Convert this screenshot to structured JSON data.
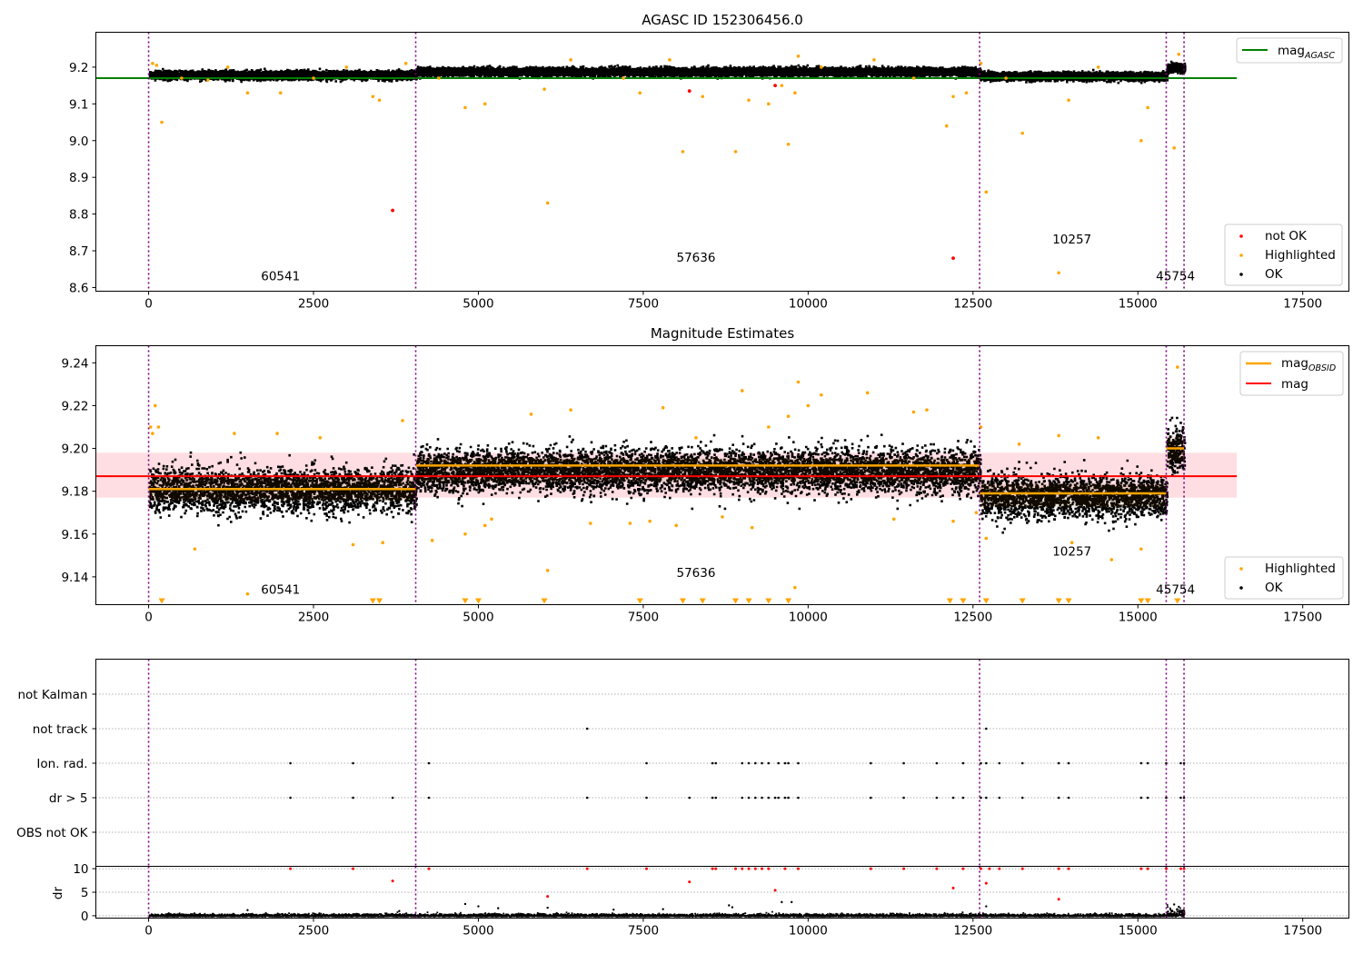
{
  "chart_data": [
    {
      "type": "scatter",
      "title": "AGASC ID 152306456.0",
      "xlabel": "",
      "ylabel": "",
      "xlim": [
        -800,
        18200
      ],
      "ylim": [
        8.59,
        9.295
      ],
      "xticks": [
        0,
        2500,
        5000,
        7500,
        10000,
        12500,
        15000,
        17500
      ],
      "xtick_labels": [
        "0",
        "2500",
        "5000",
        "7500",
        "10000",
        "12500",
        "15000",
        "17500"
      ],
      "yticks": [
        8.6,
        8.7,
        8.8,
        8.9,
        9.0,
        9.1,
        9.2
      ],
      "ytick_labels": [
        "8.6",
        "8.7",
        "8.8",
        "8.9",
        "9.0",
        "9.1",
        "9.2"
      ],
      "obsid_boundaries": [
        0,
        4050,
        12600,
        15430,
        15700
      ],
      "obsid_labels": [
        {
          "text": "60541",
          "x": 2000,
          "y": 8.62
        },
        {
          "text": "57636",
          "x": 8300,
          "y": 8.67
        },
        {
          "text": "10257",
          "x": 14000,
          "y": 8.72
        },
        {
          "text": "45754",
          "x": 15570,
          "y": 8.62
        }
      ],
      "lines": [
        {
          "name": "mag_AGASC",
          "y": 9.17,
          "x_range": [
            -800,
            16500
          ],
          "color": "#008000"
        }
      ],
      "ok_bands": [
        {
          "x_range": [
            0,
            4050
          ],
          "center": 9.181,
          "spread": 0.011
        },
        {
          "x_range": [
            4050,
            12600
          ],
          "center": 9.19,
          "spread": 0.011
        },
        {
          "x_range": [
            12600,
            15430
          ],
          "center": 9.178,
          "spread": 0.011
        },
        {
          "x_range": [
            15430,
            15700
          ],
          "center": 9.2,
          "spread": 0.012
        }
      ],
      "highlighted_points": [
        [
          60,
          9.21
        ],
        [
          120,
          9.205
        ],
        [
          200,
          9.05
        ],
        [
          500,
          9.17
        ],
        [
          900,
          9.165
        ],
        [
          1200,
          9.2
        ],
        [
          1500,
          9.13
        ],
        [
          2000,
          9.13
        ],
        [
          2500,
          9.17
        ],
        [
          3000,
          9.2
        ],
        [
          3400,
          9.12
        ],
        [
          3500,
          9.11
        ],
        [
          3900,
          9.21
        ],
        [
          4400,
          9.17
        ],
        [
          4800,
          9.09
        ],
        [
          5100,
          9.1
        ],
        [
          6000,
          9.14
        ],
        [
          6050,
          8.83
        ],
        [
          6400,
          9.22
        ],
        [
          7200,
          9.17
        ],
        [
          7450,
          9.13
        ],
        [
          7900,
          9.22
        ],
        [
          8100,
          8.97
        ],
        [
          8400,
          9.12
        ],
        [
          8900,
          8.97
        ],
        [
          9100,
          9.11
        ],
        [
          9400,
          9.1
        ],
        [
          9600,
          9.15
        ],
        [
          9700,
          8.99
        ],
        [
          9800,
          9.13
        ],
        [
          9850,
          9.23
        ],
        [
          10200,
          9.2
        ],
        [
          11000,
          9.22
        ],
        [
          11600,
          9.17
        ],
        [
          12100,
          9.04
        ],
        [
          12200,
          9.12
        ],
        [
          12400,
          9.13
        ],
        [
          12620,
          9.21
        ],
        [
          12700,
          8.86
        ],
        [
          13000,
          9.17
        ],
        [
          13250,
          9.02
        ],
        [
          13800,
          8.64
        ],
        [
          13950,
          9.11
        ],
        [
          14400,
          9.2
        ],
        [
          15050,
          9.0
        ],
        [
          15150,
          9.09
        ],
        [
          15550,
          8.98
        ],
        [
          15620,
          9.235
        ]
      ],
      "not_ok_points": [
        [
          3700,
          8.81
        ],
        [
          8200,
          9.135
        ],
        [
          9500,
          9.15
        ],
        [
          12200,
          8.68
        ]
      ],
      "legend": [
        {
          "name": "mag_AGASC",
          "position": "top-right"
        },
        {
          "name": "not OK",
          "position": "bottom-right"
        },
        {
          "name": "Highlighted",
          "position": "bottom-right"
        },
        {
          "name": "OK",
          "position": "bottom-right"
        }
      ],
      "grid": false
    },
    {
      "type": "scatter",
      "title": "Magnitude Estimates",
      "xlabel": "",
      "ylabel": "",
      "xlim": [
        -800,
        18200
      ],
      "ylim": [
        9.127,
        9.248
      ],
      "xticks": [
        0,
        2500,
        5000,
        7500,
        10000,
        12500,
        15000,
        17500
      ],
      "xtick_labels": [
        "0",
        "2500",
        "5000",
        "7500",
        "10000",
        "12500",
        "15000",
        "17500"
      ],
      "yticks": [
        9.14,
        9.16,
        9.18,
        9.2,
        9.22,
        9.24
      ],
      "ytick_labels": [
        "9.14",
        "9.16",
        "9.18",
        "9.20",
        "9.22",
        "9.24"
      ],
      "obsid_boundaries": [
        0,
        4050,
        12600,
        15430,
        15700
      ],
      "obsid_labels": [
        {
          "text": "60541",
          "x": 2000,
          "y": 9.132
        },
        {
          "text": "57636",
          "x": 8300,
          "y": 9.14
        },
        {
          "text": "10257",
          "x": 14000,
          "y": 9.15
        },
        {
          "text": "45754",
          "x": 15570,
          "y": 9.132
        }
      ],
      "mag": {
        "value": 9.187,
        "band": [
          9.177,
          9.198
        ],
        "x_range": [
          -800,
          16500
        ],
        "color": "#ff0000"
      },
      "mag_obsid": [
        {
          "x_range": [
            0,
            4050
          ],
          "value": 9.181
        },
        {
          "x_range": [
            4050,
            12600
          ],
          "value": 9.192
        },
        {
          "x_range": [
            12600,
            15430
          ],
          "value": 9.179
        },
        {
          "x_range": [
            15430,
            15700
          ],
          "value": 9.2
        }
      ],
      "ok_bands": [
        {
          "x_range": [
            0,
            4050
          ],
          "center": 9.181,
          "spread": 0.011
        },
        {
          "x_range": [
            4050,
            12600
          ],
          "center": 9.19,
          "spread": 0.011
        },
        {
          "x_range": [
            12600,
            15430
          ],
          "center": 9.178,
          "spread": 0.011
        },
        {
          "x_range": [
            15430,
            15700
          ],
          "center": 9.2,
          "spread": 0.012
        }
      ],
      "highlighted_points": [
        [
          30,
          9.21
        ],
        [
          60,
          9.207
        ],
        [
          100,
          9.22
        ],
        [
          150,
          9.21
        ],
        [
          700,
          9.153
        ],
        [
          1300,
          9.207
        ],
        [
          1500,
          9.132
        ],
        [
          1950,
          9.207
        ],
        [
          2600,
          9.205
        ],
        [
          3100,
          9.155
        ],
        [
          3550,
          9.156
        ],
        [
          3850,
          9.213
        ],
        [
          4300,
          9.157
        ],
        [
          4800,
          9.16
        ],
        [
          5100,
          9.164
        ],
        [
          5200,
          9.167
        ],
        [
          5800,
          9.216
        ],
        [
          6050,
          9.143
        ],
        [
          6400,
          9.218
        ],
        [
          6700,
          9.165
        ],
        [
          7300,
          9.165
        ],
        [
          7600,
          9.166
        ],
        [
          7800,
          9.219
        ],
        [
          8000,
          9.164
        ],
        [
          8300,
          9.205
        ],
        [
          8700,
          9.168
        ],
        [
          9000,
          9.227
        ],
        [
          9150,
          9.163
        ],
        [
          9400,
          9.21
        ],
        [
          9700,
          9.215
        ],
        [
          9800,
          9.135
        ],
        [
          9850,
          9.231
        ],
        [
          10000,
          9.22
        ],
        [
          10200,
          9.225
        ],
        [
          10900,
          9.226
        ],
        [
          11300,
          9.167
        ],
        [
          11600,
          9.217
        ],
        [
          11800,
          9.218
        ],
        [
          12200,
          9.166
        ],
        [
          12550,
          9.17
        ],
        [
          12620,
          9.21
        ],
        [
          12700,
          9.158
        ],
        [
          13200,
          9.202
        ],
        [
          13800,
          9.206
        ],
        [
          14000,
          9.156
        ],
        [
          14400,
          9.205
        ],
        [
          14600,
          9.148
        ],
        [
          15050,
          9.153
        ],
        [
          15600,
          9.238
        ]
      ],
      "clipped_low_points": [
        200,
        3400,
        3500,
        4800,
        5000,
        6000,
        7450,
        8100,
        8400,
        8900,
        9100,
        9400,
        9700,
        12150,
        12350,
        12700,
        13250,
        13800,
        13950,
        15050,
        15150,
        15600
      ],
      "legend": [
        {
          "name": "mag_OBSID",
          "position": "top-right"
        },
        {
          "name": "mag",
          "position": "top-right"
        },
        {
          "name": "Highlighted",
          "position": "bottom-right"
        },
        {
          "name": "OK",
          "position": "bottom-right"
        }
      ],
      "grid": false
    },
    {
      "type": "scatter",
      "title": "",
      "xlabel": "",
      "ylabel": "",
      "xlim": [
        -800,
        18200
      ],
      "xticks": [
        0,
        2500,
        5000,
        7500,
        10000,
        12500,
        15000,
        17500
      ],
      "xtick_labels": [
        "0",
        "2500",
        "5000",
        "7500",
        "10000",
        "12500",
        "15000",
        "17500"
      ],
      "categories": [
        "not Kalman",
        "not track",
        "Ion. rad.",
        "dr > 5",
        "OBS not OK"
      ],
      "obsid_boundaries": [
        0,
        4050,
        12600,
        15430,
        15700
      ],
      "flags": {
        "not Kalman": [],
        "not track": [
          6650,
          12700
        ],
        "Ion. rad.": [
          2150,
          3100,
          4250,
          7550,
          8550,
          8600,
          9000,
          9100,
          9200,
          9300,
          9400,
          9550,
          9650,
          9700,
          9850,
          10950,
          11450,
          11950,
          12350,
          12620,
          12700,
          12900,
          13250,
          13800,
          13950,
          15050,
          15150,
          15430,
          15650,
          15700
        ],
        "dr > 5": [
          2150,
          3100,
          3700,
          4250,
          6650,
          7550,
          8200,
          8550,
          8600,
          9000,
          9100,
          9200,
          9300,
          9400,
          9500,
          9550,
          9650,
          9700,
          9850,
          10950,
          11450,
          11950,
          12200,
          12350,
          12620,
          12700,
          12900,
          13250,
          13800,
          13950,
          15050,
          15150,
          15430,
          15650,
          15700
        ],
        "OBS not OK": []
      },
      "grid": true
    },
    {
      "type": "scatter",
      "title": "",
      "xlabel": "",
      "ylabel": "dr",
      "xlim": [
        -800,
        18200
      ],
      "ylim": [
        -0.5,
        10.5
      ],
      "xticks": [
        0,
        2500,
        5000,
        7500,
        10000,
        12500,
        15000,
        17500
      ],
      "xtick_labels": [
        "0",
        "2500",
        "5000",
        "7500",
        "10000",
        "12500",
        "15000",
        "17500"
      ],
      "yticks": [
        0,
        5,
        10
      ],
      "ytick_labels": [
        "0",
        "5",
        "10"
      ],
      "obsid_boundaries": [
        0,
        4050,
        12600,
        15430,
        15700
      ],
      "red_points": [
        [
          2150,
          10
        ],
        [
          3100,
          10
        ],
        [
          3700,
          7.4
        ],
        [
          4250,
          10
        ],
        [
          6050,
          4.1
        ],
        [
          6650,
          10
        ],
        [
          7550,
          10
        ],
        [
          8200,
          7.2
        ],
        [
          8550,
          10
        ],
        [
          8600,
          10
        ],
        [
          8900,
          10
        ],
        [
          9000,
          10
        ],
        [
          9100,
          10
        ],
        [
          9200,
          10
        ],
        [
          9300,
          10
        ],
        [
          9400,
          10
        ],
        [
          9500,
          5.4
        ],
        [
          9650,
          10
        ],
        [
          9850,
          10
        ],
        [
          10950,
          10
        ],
        [
          11450,
          10
        ],
        [
          11950,
          10
        ],
        [
          12200,
          5.9
        ],
        [
          12350,
          10
        ],
        [
          12620,
          10
        ],
        [
          12700,
          6.9
        ],
        [
          12750,
          10
        ],
        [
          12900,
          10
        ],
        [
          13250,
          10
        ],
        [
          13800,
          3.5
        ],
        [
          13800,
          10
        ],
        [
          13950,
          10
        ],
        [
          15050,
          10
        ],
        [
          15150,
          10
        ],
        [
          15430,
          10
        ],
        [
          15650,
          10
        ],
        [
          15700,
          10
        ]
      ],
      "black_outliers": [
        [
          1500,
          1.2
        ],
        [
          3800,
          1.0
        ],
        [
          4800,
          2.5
        ],
        [
          5000,
          2.0
        ],
        [
          5300,
          1.6
        ],
        [
          6050,
          1.7
        ],
        [
          7050,
          1.3
        ],
        [
          7800,
          1.4
        ],
        [
          8800,
          2.2
        ],
        [
          8850,
          1.8
        ],
        [
          9600,
          2.9
        ],
        [
          9750,
          2.9
        ],
        [
          12700,
          2.0
        ],
        [
          15550,
          2.4
        ],
        [
          15620,
          1.9
        ]
      ],
      "grid": true
    }
  ]
}
